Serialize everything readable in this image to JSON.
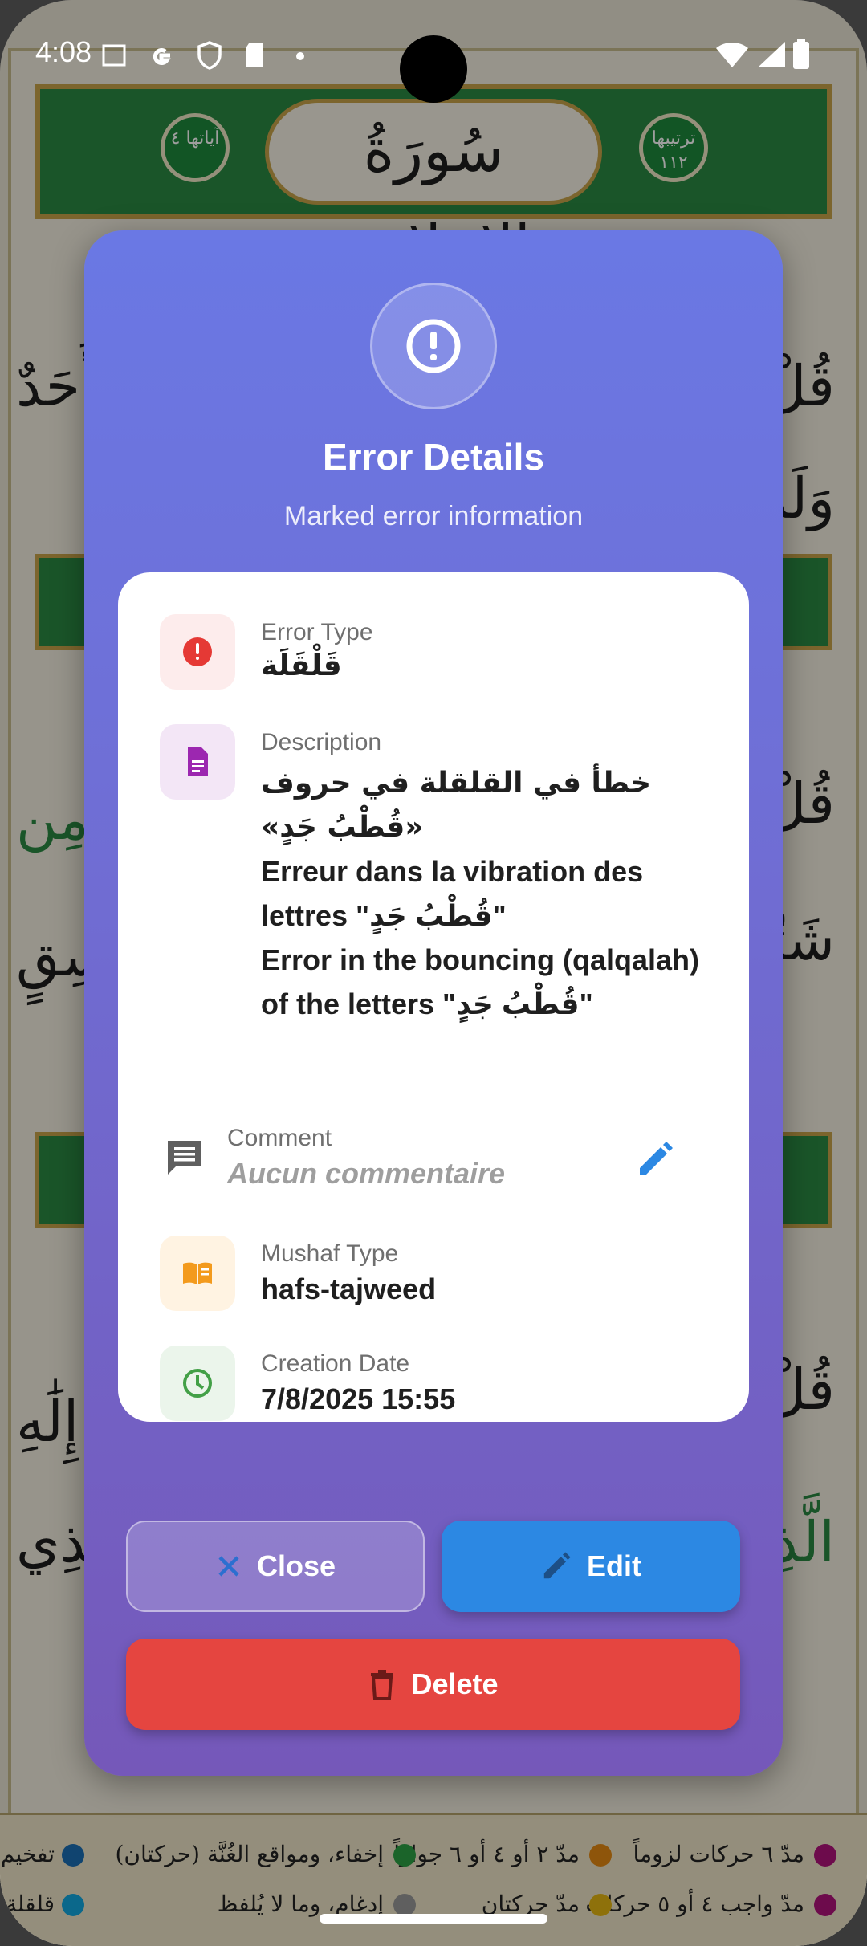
{
  "status_bar": {
    "time": "4:08"
  },
  "background": {
    "sura_name": "سُورَةُ الإِخلاص",
    "medal_left": "آياتها ٤",
    "medal_right": "ترتيبها ١١٢",
    "line_1_right": "قُلْ",
    "line_1_left": "أَحَدٌ",
    "line_2_right": "وَلَمْ",
    "line_3_right": "قُلْ",
    "line_3_left": "مِن",
    "line_4_right": "شَرِّ",
    "line_4_left": "غَاسِقٍ",
    "line_5_right": "قُلْ",
    "line_5_left": "إِلَٰهِ",
    "line_6_right": "الَّذِي",
    "line_6_left": "الَّذِي",
    "legend": [
      {
        "text": "مدّ ٦ حركات لزوماً",
        "color": "#b0127b"
      },
      {
        "text": "مدّ ٢ أو ٤ أو ٦ جوازاً",
        "color": "#e58a13"
      },
      {
        "text": "إخفاء، ومواقع الغُنَّة (حركتان)",
        "color": "#2da245"
      },
      {
        "text": "تفخيم",
        "color": "#1b6fb5"
      },
      {
        "text": "مدّ واجب ٤ أو ٥ حركات",
        "color": "#b0127b"
      },
      {
        "text": "مدّ حركتان",
        "color": "#e5b713"
      },
      {
        "text": "إدغام، وما لا يُلفظ",
        "color": "#9a9a9a"
      },
      {
        "text": "قلقلة",
        "color": "#13a9e0"
      }
    ]
  },
  "dialog": {
    "title": "Error Details",
    "subtitle": "Marked error information",
    "header_icon": "alert-circle-icon",
    "rows": {
      "error_type": {
        "label": "Error Type",
        "value": "قَلْقَلَة",
        "icon": "error-icon",
        "icon_color": "#e53935",
        "icon_bg": "#fdecec"
      },
      "description": {
        "label": "Description",
        "line_ar": "خطأ في القلقلة في حروف «قُطْبُ جَدٍ»",
        "line_fr": "Erreur dans la vibration des lettres \"قُطْبُ جَدٍ\"",
        "line_en": "Error in the bouncing (qalqalah) of the letters \"قُطْبُ جَدٍ\"",
        "icon": "document-icon",
        "icon_color": "#9c27b0",
        "icon_bg": "#f3e6f6"
      },
      "comment": {
        "label": "Comment",
        "value": "Aucun commentaire",
        "icon": "comment-icon",
        "edit_icon": "pencil-icon"
      },
      "mushaf_type": {
        "label": "Mushaf Type",
        "value": "hafs-tajweed",
        "icon": "book-icon",
        "icon_color": "#f39a1d",
        "icon_bg": "#fff3e2"
      },
      "creation_date": {
        "label": "Creation Date",
        "value": "7/8/2025 15:55",
        "icon": "clock-icon",
        "icon_color": "#43a047",
        "icon_bg": "#ebf5eb"
      }
    },
    "buttons": {
      "close": "Close",
      "edit": "Edit",
      "delete": "Delete"
    }
  },
  "colors": {
    "dialog_gradient_top": "#6a78e4",
    "dialog_gradient_bottom": "#7558b9",
    "edit_button": "#2c88e3",
    "delete_button": "#e54540",
    "comment_edit_icon": "#2c88e3"
  }
}
